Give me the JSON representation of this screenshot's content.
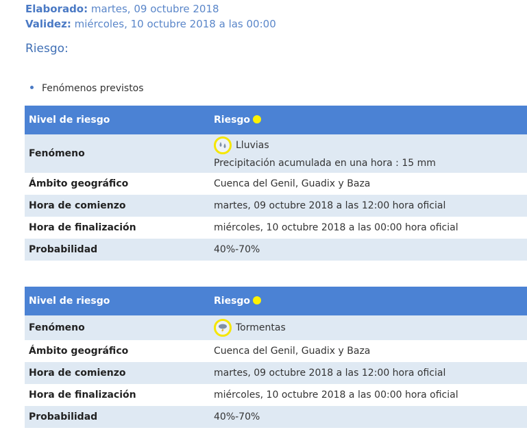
{
  "meta": {
    "elaborado_label": "Elaborado:",
    "elaborado_value": "martes, 09 octubre 2018",
    "validez_label": "Validez:",
    "validez_value": "miércoles, 10 octubre 2018 a las 00:00"
  },
  "riesgo_title": "Riesgo:",
  "bullet": "Fenómenos previstos",
  "colors": {
    "header_bg": "#4b82d4",
    "alt_row_bg": "#dfe9f3",
    "risk_yellow": "#fff200",
    "link_blue": "#5a86c9"
  },
  "tables": [
    {
      "header": {
        "col1": "Nivel de riesgo",
        "col2": "Riesgo"
      },
      "risk_level_color": "yellow",
      "phenomenon_icon": "rain-icon",
      "rows": {
        "fenomeno_label": "Fenómeno",
        "fenomeno_value": "Lluvias",
        "fenomeno_detail": "Precipitación acumulada en una hora : 15 mm",
        "ambito_label": "Ámbito geográfico",
        "ambito_value": "Cuenca del Genil, Guadix y Baza",
        "comienzo_label": "Hora de comienzo",
        "comienzo_value": "martes, 09 octubre 2018 a las 12:00 hora oficial",
        "fin_label": "Hora de finalización",
        "fin_value": "miércoles, 10 octubre 2018 a las 00:00 hora oficial",
        "prob_label": "Probabilidad",
        "prob_value": "40%-70%"
      }
    },
    {
      "header": {
        "col1": "Nivel de riesgo",
        "col2": "Riesgo"
      },
      "risk_level_color": "yellow",
      "phenomenon_icon": "storm-icon",
      "rows": {
        "fenomeno_label": "Fenómeno",
        "fenomeno_value": "Tormentas",
        "ambito_label": "Ámbito geográfico",
        "ambito_value": "Cuenca del Genil, Guadix y Baza",
        "comienzo_label": "Hora de comienzo",
        "comienzo_value": "martes, 09 octubre 2018 a las 12:00 hora oficial",
        "fin_label": "Hora de finalización",
        "fin_value": "miércoles, 10 octubre 2018 a las 00:00 hora oficial",
        "prob_label": "Probabilidad",
        "prob_value": "40%-70%"
      }
    }
  ]
}
